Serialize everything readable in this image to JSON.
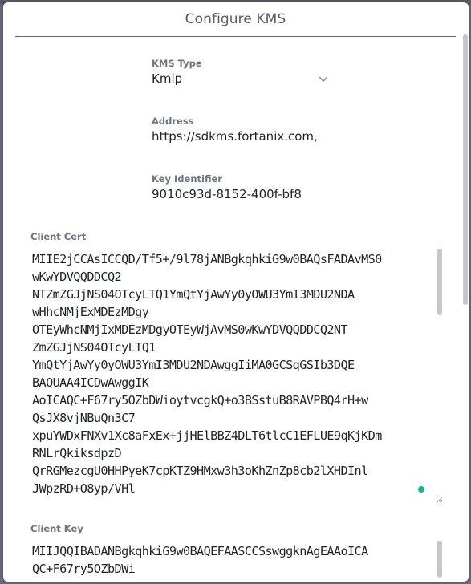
{
  "dialog": {
    "title": "Configure KMS"
  },
  "kms_type": {
    "label": "KMS Type",
    "value": "Kmip",
    "icon": "chevron-down-icon"
  },
  "address": {
    "label": "Address",
    "value": "https://sdkms.fortanix.com,"
  },
  "key_identifier": {
    "label": "Key Identifier",
    "value": "9010c93d-8152-400f-bf8"
  },
  "client_cert": {
    "label": "Client Cert",
    "lines": [
      "MIIE2jCCAsICCQD/Tf5+/9l78jANBgkqhkiG9w0BAQsFADAvMS0",
      "wKwYDVQQDDCQ2",
      "NTZmZGJjNS04OTcyLTQ1YmQtYjAwYy0yOWU3YmI3MDU2NDA",
      "wHhcNMjExMDEzMDgy",
      "OTEyWhcNMjIxMDEzMDgyOTEyWjAvMS0wKwYDVQQDDCQ2NT",
      "ZmZGJjNS04OTcyLTQ1",
      "YmQtYjAwYy0yOWU3YmI3MDU2NDAwggIiMA0GCSqGSIb3DQE",
      "BAQUAA4ICDwAwggIK",
      "AoICAQC+F67ry5OZbDWioytvcgkQ+o3BSstuB8RAVPBQ4rH+w",
      "QsJX8vjNBuQn3C7",
      "xpuYWDxFNXv1Xc8aFxEx+jjHElBBZ4DLT6tlcC1EFLUE9qKjKDm",
      "RNLrQkiksdpzD",
      "QrRGMezcgU0HHPyeK7cpKTZ9HMxw3h3oKhZnZp8cb2lXHDInl",
      "JWpzRD+O8yp/VHl"
    ]
  },
  "client_key": {
    "label": "Client Key",
    "lines": [
      "MIIJQQIBADANBgkqhkiG9w0BAQEFAASCCSswggknAgEAAoICA",
      "QC+F67ry5OZbDWi"
    ]
  }
}
